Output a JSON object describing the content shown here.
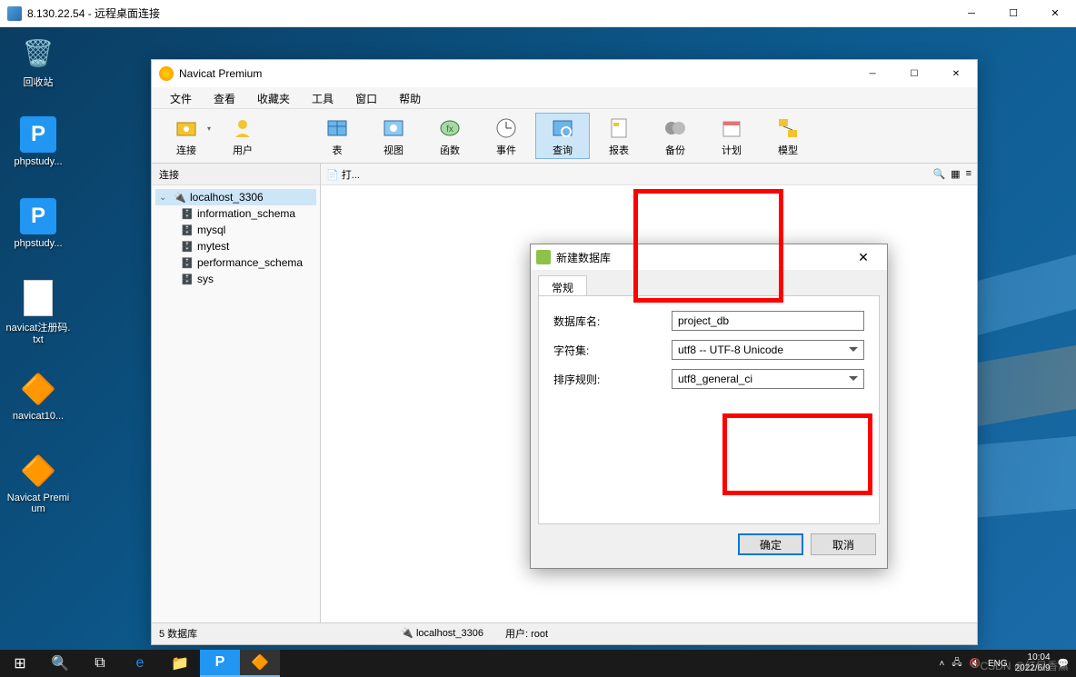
{
  "rdp": {
    "title": "8.130.22.54 - 远程桌面连接"
  },
  "desktop_icons": {
    "recycle": "回收站",
    "phpstudy1": "phpstudy...",
    "phpstudy2": "phpstudy...",
    "txtfile": "navicat注册码.txt",
    "navicat10": "navicat10...",
    "navicat_premium": "Navicat Premium"
  },
  "navicat": {
    "title": "Navicat Premium",
    "menu": [
      "文件",
      "查看",
      "收藏夹",
      "工具",
      "窗口",
      "帮助"
    ],
    "toolbar": [
      "连接",
      "用户",
      "表",
      "视图",
      "函数",
      "事件",
      "查询",
      "报表",
      "备份",
      "计划",
      "模型"
    ],
    "sidebar_header": "连接",
    "connection": "localhost_3306",
    "databases": [
      "information_schema",
      "mysql",
      "mytest",
      "performance_schema",
      "sys"
    ],
    "content_open": "打...",
    "status_left": "5 数据库",
    "status_conn": "localhost_3306",
    "status_user": "用户: root"
  },
  "dialog": {
    "title": "新建数据库",
    "tab": "常规",
    "label_dbname": "数据库名:",
    "label_charset": "字符集:",
    "label_collation": "排序规则:",
    "value_dbname": "project_db",
    "value_charset": "utf8 -- UTF-8 Unicode",
    "value_collation": "utf8_general_ci",
    "btn_ok": "确定",
    "btn_cancel": "取消"
  },
  "taskbar": {
    "lang": "ENG",
    "time": "10:04",
    "date": "2022/6/9"
  },
  "watermark": "CSDN @红目香薰"
}
